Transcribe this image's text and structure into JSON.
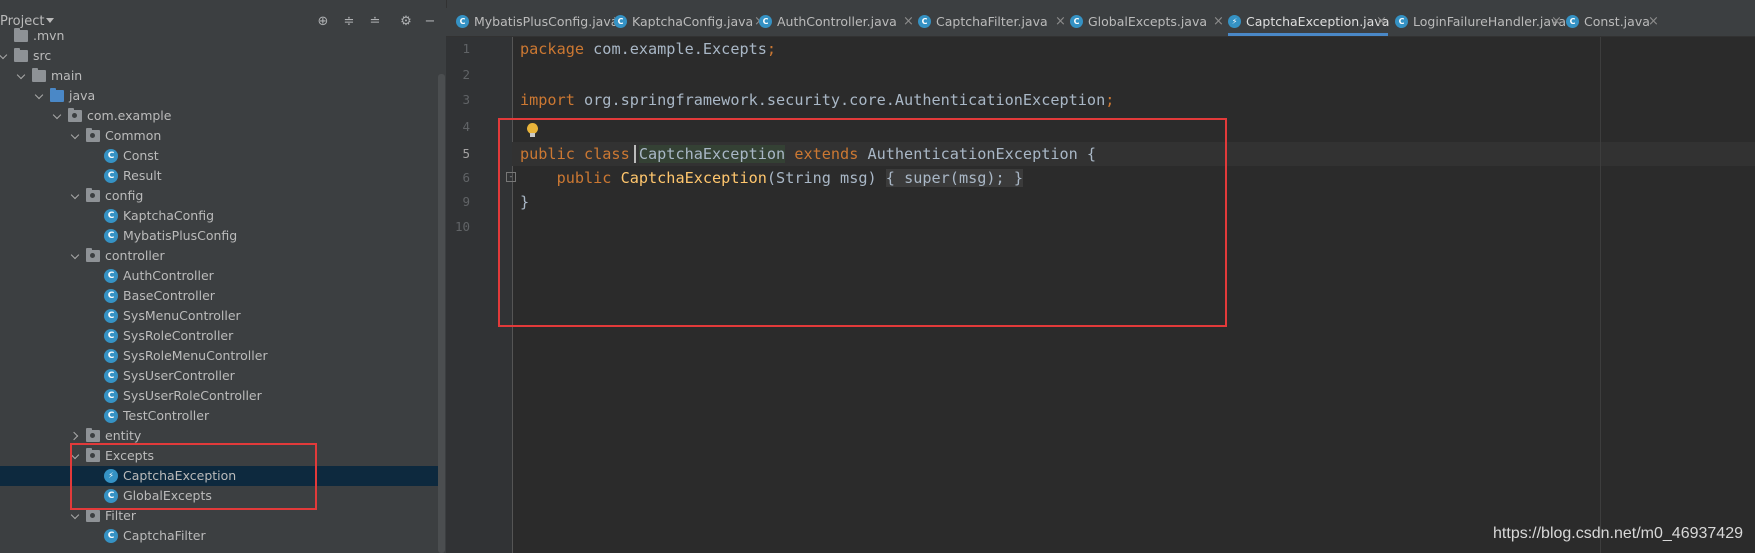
{
  "panel": {
    "title": "Project"
  },
  "tree": [
    {
      "label": ".mvn",
      "icon": "folder"
    },
    {
      "label": "src",
      "icon": "folder"
    },
    {
      "label": "main",
      "icon": "folder"
    },
    {
      "label": "java",
      "icon": "source-folder"
    },
    {
      "label": "com.example",
      "icon": "package"
    },
    {
      "label": "Common",
      "icon": "package"
    },
    {
      "label": "Const",
      "icon": "class"
    },
    {
      "label": "Result",
      "icon": "class"
    },
    {
      "label": "config",
      "icon": "package"
    },
    {
      "label": "KaptchaConfig",
      "icon": "class"
    },
    {
      "label": "MybatisPlusConfig",
      "icon": "class"
    },
    {
      "label": "controller",
      "icon": "package"
    },
    {
      "label": "AuthController",
      "icon": "class"
    },
    {
      "label": "BaseController",
      "icon": "class"
    },
    {
      "label": "SysMenuController",
      "icon": "class"
    },
    {
      "label": "SysRoleController",
      "icon": "class"
    },
    {
      "label": "SysRoleMenuController",
      "icon": "class"
    },
    {
      "label": "SysUserController",
      "icon": "class"
    },
    {
      "label": "SysUserRoleController",
      "icon": "class"
    },
    {
      "label": "TestController",
      "icon": "class"
    },
    {
      "label": "entity",
      "icon": "package"
    },
    {
      "label": "Excepts",
      "icon": "package"
    },
    {
      "label": "CaptchaException",
      "icon": "exception-class",
      "selected": true
    },
    {
      "label": "GlobalExcepts",
      "icon": "class"
    },
    {
      "label": "Filter",
      "icon": "package"
    },
    {
      "label": "CaptchaFilter",
      "icon": "class"
    }
  ],
  "tabs": [
    {
      "label": "MybatisPlusConfig.java"
    },
    {
      "label": "KaptchaConfig.java"
    },
    {
      "label": "AuthController.java"
    },
    {
      "label": "CaptchaFilter.java"
    },
    {
      "label": "GlobalExcepts.java"
    },
    {
      "label": "CaptchaException.java",
      "active": true
    },
    {
      "label": "LoginFailureHandler.java"
    },
    {
      "label": "Const.java"
    }
  ],
  "gutter": {
    "line_numbers": [
      "1",
      "2",
      "3",
      "4",
      "5",
      "6",
      "9",
      "10"
    ],
    "current_line": "5"
  },
  "code": {
    "l1_kw": "package",
    "l1_rest": " com.example.Excepts",
    "l1_semi": ";",
    "l3_kw": "import",
    "l3_rest": " org.springframework.security.core.AuthenticationException",
    "l3_semi": ";",
    "l5_kw1": "public class ",
    "l5_name": "CaptchaException",
    "l5_kw2": " extends ",
    "l5_rest": "AuthenticationException {",
    "l6_indent": "    ",
    "l6_kw": "public ",
    "l6_fn": "CaptchaException",
    "l6_args": "(String msg) ",
    "l6_open": "{ ",
    "l6_super": "super",
    "l6_call": "(msg)",
    "l6_semi": ";",
    "l6_close": " }",
    "l9": "}"
  },
  "watermark": "https://blog.csdn.net/m0_46937429"
}
